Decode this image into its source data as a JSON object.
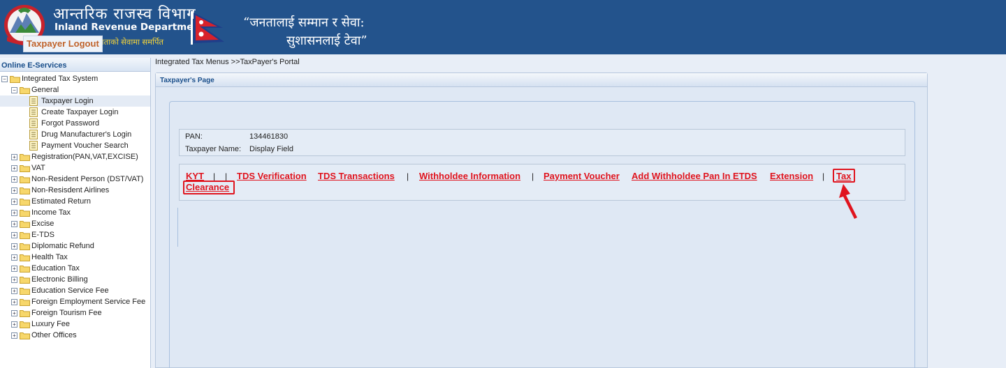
{
  "header": {
    "title_np": "आन्तरिक राजस्व विभाग",
    "title_en": "Inland Revenue Department",
    "subtitle_np": "करदाताको सेवामा समर्पित",
    "slogan_line1": "“जनतालाई सम्मान र सेवा:",
    "slogan_line2": "सुशासनलाई टेवा”"
  },
  "sidebar": {
    "heading": "Online E-Services",
    "items": [
      {
        "label": "Integrated Tax System"
      },
      {
        "label": "General"
      },
      {
        "label": "Taxpayer Login"
      },
      {
        "label": "Create Taxpayer Login"
      },
      {
        "label": "Forgot Password"
      },
      {
        "label": "Drug Manufacturer's Login"
      },
      {
        "label": "Payment Voucher Search"
      },
      {
        "label": "Registration(PAN,VAT,EXCISE)"
      },
      {
        "label": "VAT"
      },
      {
        "label": "Non-Resident Person (DST/VAT)"
      },
      {
        "label": "Non-Resisdent Airlines"
      },
      {
        "label": "Estimated Return"
      },
      {
        "label": "Income Tax"
      },
      {
        "label": "Excise"
      },
      {
        "label": "E-TDS"
      },
      {
        "label": "Diplomatic Refund"
      },
      {
        "label": "Health Tax"
      },
      {
        "label": "Education Tax"
      },
      {
        "label": "Electronic Billing"
      },
      {
        "label": "Education Service Fee"
      },
      {
        "label": "Foreign Employment Service Fee"
      },
      {
        "label": "Foreign Tourism Fee"
      },
      {
        "label": "Luxury Fee"
      },
      {
        "label": "Other Offices"
      }
    ]
  },
  "breadcrumb": "Integrated Tax Menus >>TaxPayer's Portal",
  "panel": {
    "title": "Taxpayer's Page",
    "legend": "Taxpayer Logout",
    "pan_label": "PAN:",
    "pan_value": "134461830",
    "name_label": "Taxpayer Name:",
    "name_value": "Display Field"
  },
  "links": {
    "kyt": "KYT",
    "tds_verification": "TDS Verification",
    "tds_transactions": "TDS Transactions",
    "withholdee_information": "Withholdee Information",
    "payment_voucher": "Payment Voucher",
    "add_withholdee": "Add Withholdee Pan In ETDS",
    "extension": "Extension",
    "tax_clearance_part1": "Tax",
    "tax_clearance_part2": "Clearance",
    "separator": "|"
  },
  "colors": {
    "header_bg": "#23538c",
    "link_red": "#e0141e",
    "legend_orange": "#c0632b",
    "panel_bg": "#dfe8f4"
  }
}
